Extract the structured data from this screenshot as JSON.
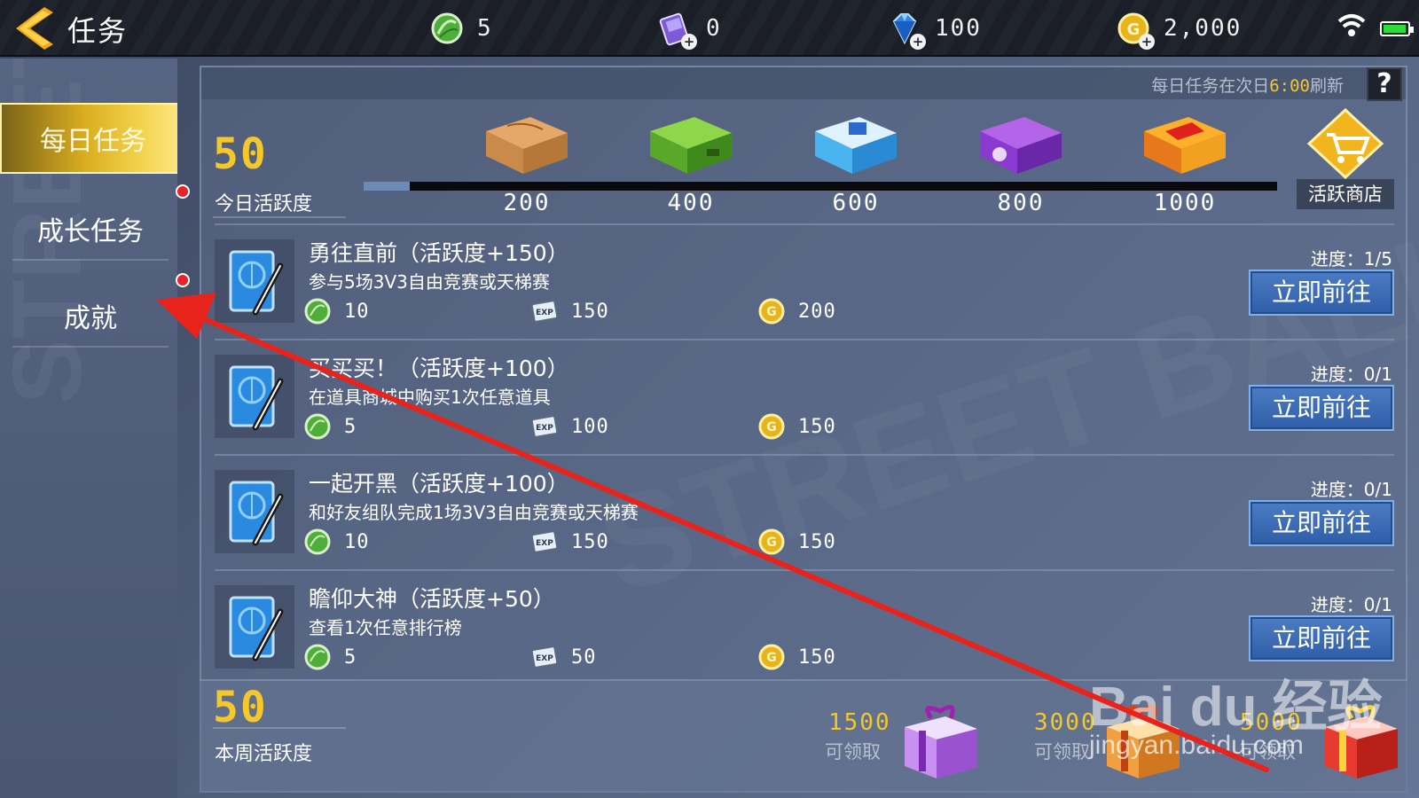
{
  "colors": {
    "accent_gold": "#f5c82a",
    "button_blue": "#2f5ea8",
    "notification_red": "#e8222a",
    "annotation_arrow": "#e8231c"
  },
  "header": {
    "title": "任务",
    "resources": [
      {
        "icon": "jade-ball-icon",
        "value": "5"
      },
      {
        "icon": "purple-card-icon",
        "value": "0"
      },
      {
        "icon": "diamond-icon",
        "value": "100"
      },
      {
        "icon": "gold-coin-icon",
        "value": "2,000"
      }
    ]
  },
  "sidebar": {
    "tabs": [
      {
        "label": "每日任务",
        "active": true
      },
      {
        "label": "成长任务",
        "active": false,
        "badge": true
      },
      {
        "label": "成就",
        "active": false,
        "badge": true
      }
    ]
  },
  "daily": {
    "refresh_prefix": "每日任务在次日",
    "refresh_time": "6:00",
    "refresh_suffix": "刷新",
    "help_label": "?",
    "activity_value": "50",
    "activity_label": "今日活跃度",
    "progress_fraction": 0.05,
    "milestones": [
      {
        "points": "200",
        "icon": "orange-box-icon"
      },
      {
        "points": "400",
        "icon": "green-box-icon"
      },
      {
        "points": "600",
        "icon": "blue-box-icon"
      },
      {
        "points": "800",
        "icon": "purple-box-icon"
      },
      {
        "points": "1000",
        "icon": "gold-box-icon"
      }
    ],
    "shop_label": "活跃商店"
  },
  "tasks": [
    {
      "title": "勇往直前（活跃度+150）",
      "desc": "参与5场3V3自由竞赛或天梯赛",
      "rewards": {
        "jade": "10",
        "exp": "150",
        "gold": "200"
      },
      "progress": "进度：1/5",
      "button": "立即前往"
    },
    {
      "title": "买买买！（活跃度+100）",
      "desc": "在道具商城中购买1次任意道具",
      "rewards": {
        "jade": "5",
        "exp": "100",
        "gold": "150"
      },
      "progress": "进度：0/1",
      "button": "立即前往"
    },
    {
      "title": "一起开黑（活跃度+100）",
      "desc": "和好友组队完成1场3V3自由竞赛或天梯赛",
      "rewards": {
        "jade": "10",
        "exp": "150",
        "gold": "150"
      },
      "progress": "进度：0/1",
      "button": "立即前往"
    },
    {
      "title": "瞻仰大神（活跃度+50）",
      "desc": "查看1次任意排行榜",
      "rewards": {
        "jade": "5",
        "exp": "50",
        "gold": "150"
      },
      "progress": "进度：0/1",
      "button": "立即前往"
    }
  ],
  "weekly": {
    "activity_value": "50",
    "activity_label": "本周活跃度",
    "gifts": [
      {
        "points": "1500",
        "status": "可领取",
        "icon": "purple-gift-icon"
      },
      {
        "points": "3000",
        "status": "可领取",
        "icon": "orange-gift-icon"
      },
      {
        "points": "5000",
        "status": "可领取",
        "icon": "red-gift-icon"
      }
    ]
  },
  "watermark": {
    "logo": "Bai du 经验",
    "url": "jingyan.baidu.com"
  }
}
